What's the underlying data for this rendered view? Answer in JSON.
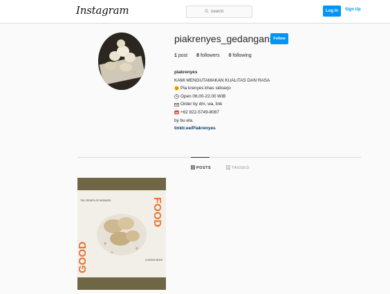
{
  "header": {
    "logo_text": "Instagram",
    "search_placeholder": "Search",
    "login_label": "Log In",
    "signup_label": "Sign Up",
    "accent_color": "#0095f6"
  },
  "profile": {
    "username": "piakrenyes_gedangansda",
    "follow_label": "Follow",
    "stats": {
      "posts_count": "1",
      "posts_label": "post",
      "followers_count": "8",
      "followers_label": "followers",
      "following_count": "0",
      "following_label": "following"
    },
    "bio": {
      "name": "piakrenyes",
      "line1": "KAMI MENGUTAMAKAN KUALITAS DAN RASA",
      "line2": "Pia krenyes khas sidoarjo",
      "line3": "Open 06.00-22.00 WIB",
      "line4": "Order by dm, wa, link",
      "line5": "+62 822-5749-8087",
      "line6": "by bu ela.",
      "link": "linktr.ee/Piakrenyes"
    }
  },
  "tabs": {
    "posts_label": "POSTS",
    "tagged_label": "TAGGED"
  },
  "post": {
    "left_word": "GOOD",
    "right_word": "FOOD",
    "small_text_top": "THE GROWTH OF BUSINESS",
    "small_text_bottom": "COOKING BOOK"
  }
}
